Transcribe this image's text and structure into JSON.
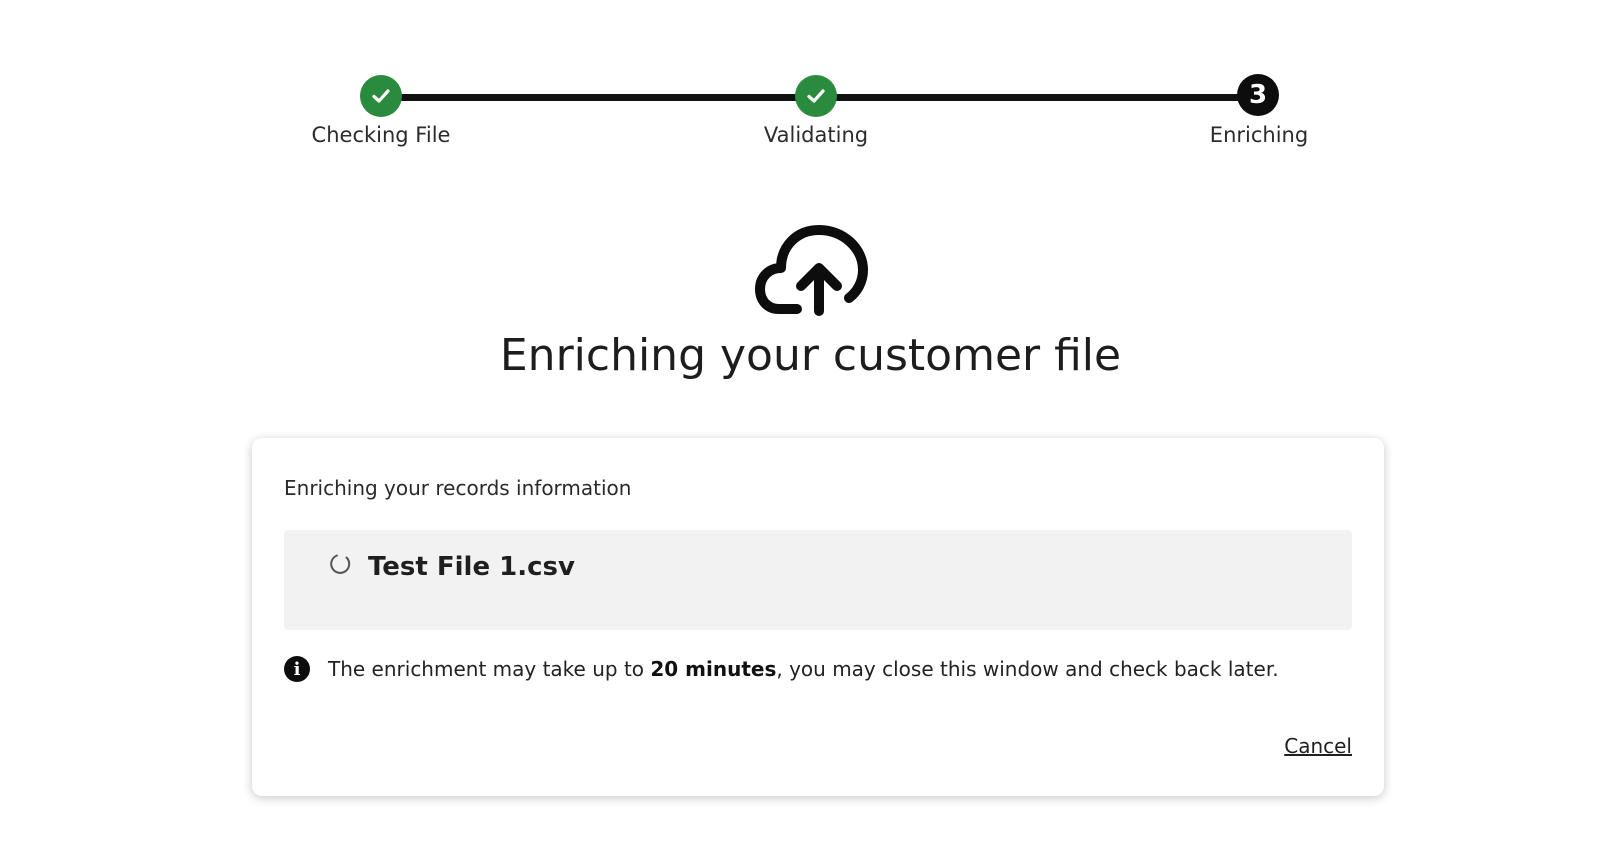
{
  "stepper": {
    "steps": [
      {
        "label": "Checking File",
        "state": "complete",
        "icon": "check-icon"
      },
      {
        "label": "Validating",
        "state": "complete",
        "icon": "check-icon"
      },
      {
        "label": "Enriching",
        "state": "current",
        "number": "3"
      }
    ],
    "colors": {
      "complete": "#2a8a3e",
      "current": "#0d0d0d",
      "line": "#111111"
    }
  },
  "hero": {
    "icon": "cloud-upload-icon",
    "title": "Enriching your customer file"
  },
  "card": {
    "subtitle": "Enriching your records information",
    "file": {
      "name": "Test File 1.csv",
      "status_icon": "loading-spinner-icon"
    },
    "notice": {
      "icon": "info-icon",
      "text_before": "The enrichment may take up to ",
      "text_bold": "20 minutes",
      "text_after": ", you may close this window and check back later."
    },
    "cancel_label": "Cancel"
  }
}
